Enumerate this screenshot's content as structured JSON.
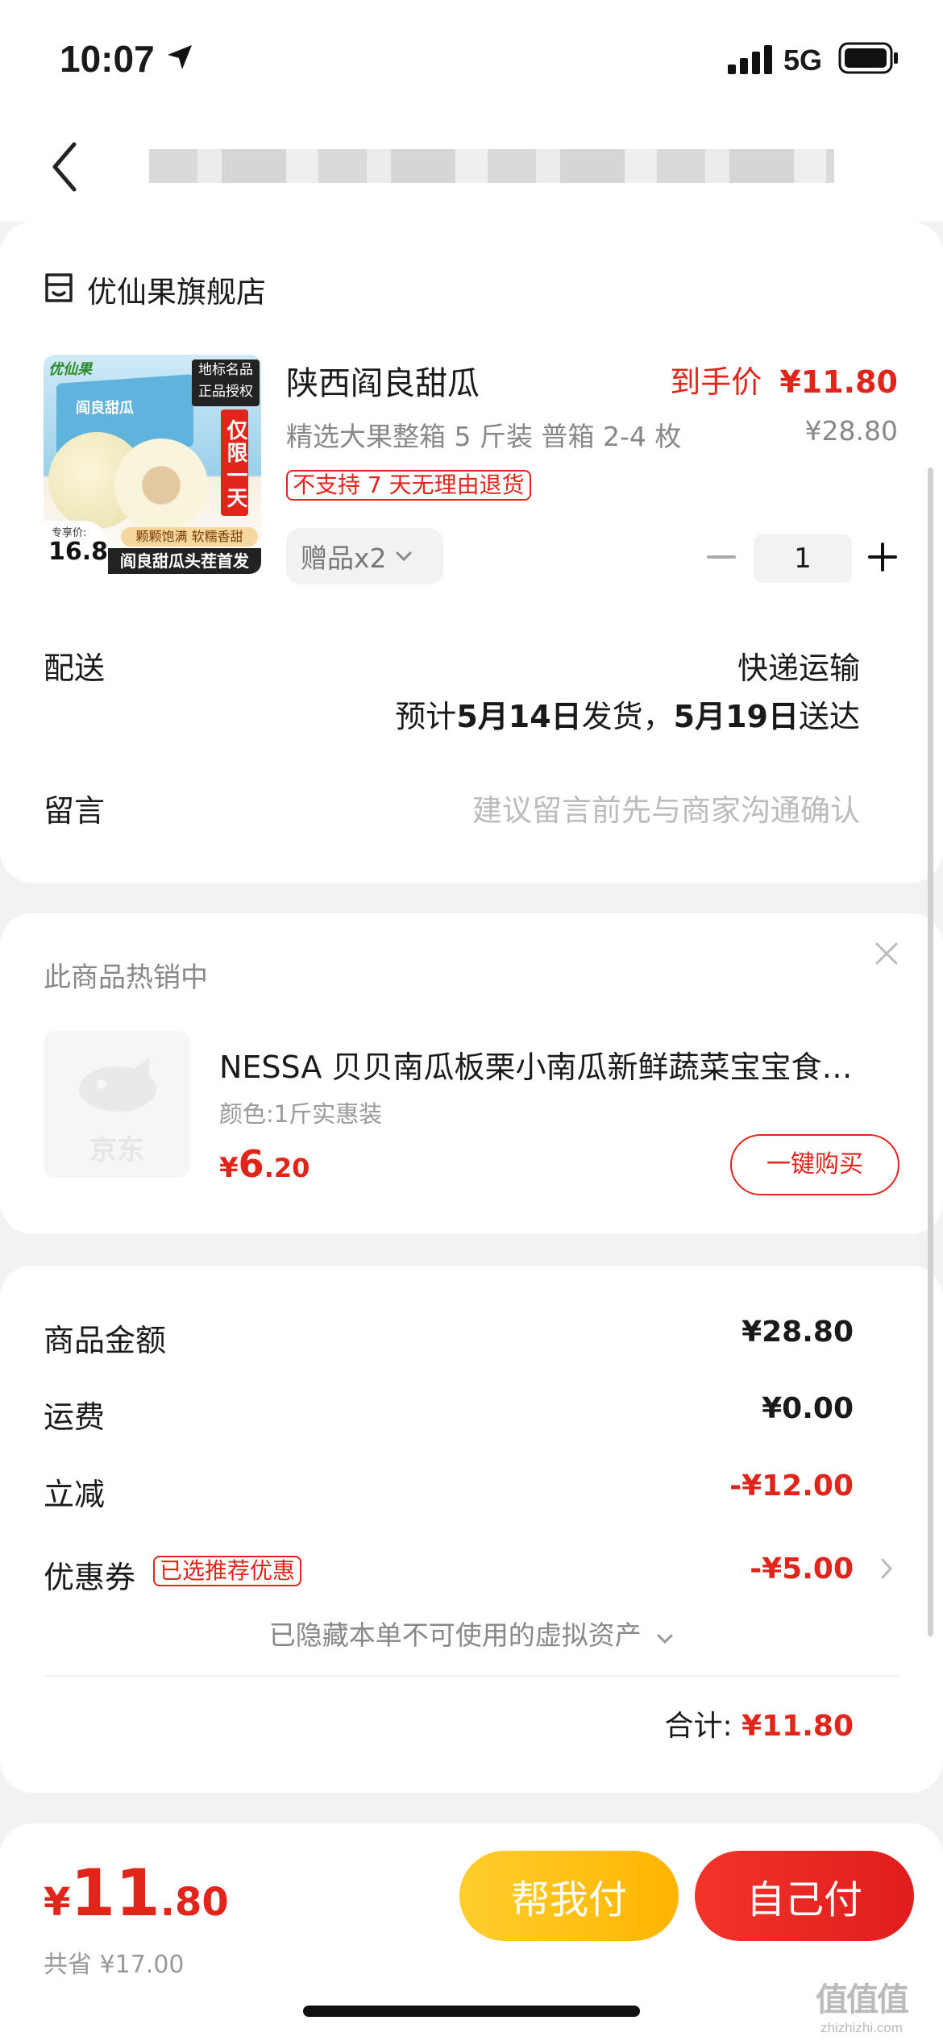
{
  "status": {
    "time": "10:07",
    "network": "5G"
  },
  "nav": {
    "title_blurred": ""
  },
  "store": {
    "name": "优仙果旗舰店",
    "product": {
      "title": "陕西阎良甜瓜",
      "price_label": "到手价",
      "price": "¥11.80",
      "spec": "精选大果整箱 5 斤装 普箱 2-4 枚",
      "original_price": "¥28.80",
      "return_tag": "不支持 7 天无理由退货",
      "gift": "赠品x2",
      "quantity": "1",
      "image": {
        "brand": "优仙果",
        "badge_top": "地标名品",
        "badge_bottom": "正品授权",
        "ribbon": "仅限一天",
        "box_title": "阎良甜瓜",
        "price_tag_label": "专享价:",
        "price_tag": "16.8",
        "slogan_top": "颗颗饱满 软糯香甜",
        "slogan_bottom": "阎良甜瓜头茬首发"
      }
    },
    "delivery": {
      "label": "配送",
      "method": "快递运输",
      "eta_prefix": "预计",
      "ship_date": "5月14日",
      "ship_suffix": "发货，",
      "arrive_date": "5月19日",
      "arrive_suffix": "送达"
    },
    "message": {
      "label": "留言",
      "placeholder": "建议留言前先与商家沟通确认"
    }
  },
  "recommend": {
    "header": "此商品热销中",
    "item_title": "NESSA 贝贝南瓜板栗小南瓜新鲜蔬菜宝宝食…",
    "item_spec": "颜色:1斤实惠装",
    "price_symbol": "¥",
    "price_int": "6",
    "price_dec": ".20",
    "buy_button": "一键购买",
    "thumb_watermark": "京东"
  },
  "summary": {
    "goods_label": "商品金额",
    "goods_value": "¥28.80",
    "shipping_label": "运费",
    "shipping_value": "¥0.00",
    "discount_label": "立减",
    "discount_value": "-¥12.00",
    "coupon_label": "优惠券",
    "coupon_tag": "已选推荐优惠",
    "coupon_value": "-¥5.00",
    "hidden_assets": "已隐藏本单不可使用的虚拟资产",
    "total_label": "合计:",
    "total_value": "¥11.80"
  },
  "footer": {
    "price_symbol": "¥",
    "price_int": "11",
    "price_dec": ".80",
    "saved": "共省 ¥17.00",
    "help_pay": "帮我付",
    "self_pay": "自己付"
  },
  "watermark": {
    "logo": "值值值",
    "site": "zhizhizhi.com"
  },
  "colors": {
    "accent": "#e1251b",
    "help_pay": "#ffc21a",
    "self_pay": "#e8261f"
  }
}
